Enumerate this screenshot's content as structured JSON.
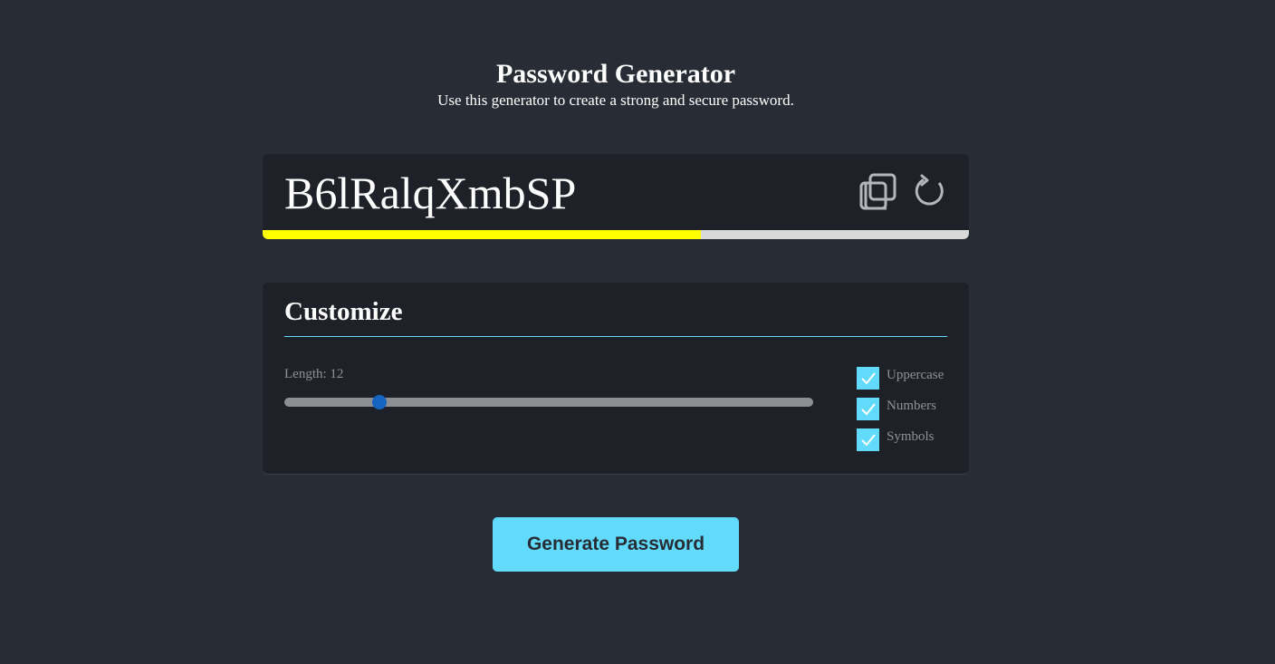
{
  "header": {
    "title": "Password Generator",
    "subtitle": "Use this generator to create a strong and secure password."
  },
  "password": {
    "value": "B6lRalqXmbSP",
    "copy_icon": "copy-icon",
    "refresh_icon": "refresh-icon",
    "strength_fraction": 0.62,
    "strength_color": "#ffff00"
  },
  "customize": {
    "title": "Customize",
    "length_label": "Length: 12",
    "length_value": 12,
    "length_slider_fraction": 0.18,
    "options": [
      {
        "label": "Uppercase",
        "checked": true
      },
      {
        "label": "Numbers",
        "checked": true
      },
      {
        "label": "Symbols",
        "checked": true
      }
    ]
  },
  "actions": {
    "generate_label": "Generate Password"
  },
  "colors": {
    "background": "#282c35",
    "card": "#1f2128",
    "accent": "#61dafb",
    "slider_thumb": "#1565c0"
  }
}
